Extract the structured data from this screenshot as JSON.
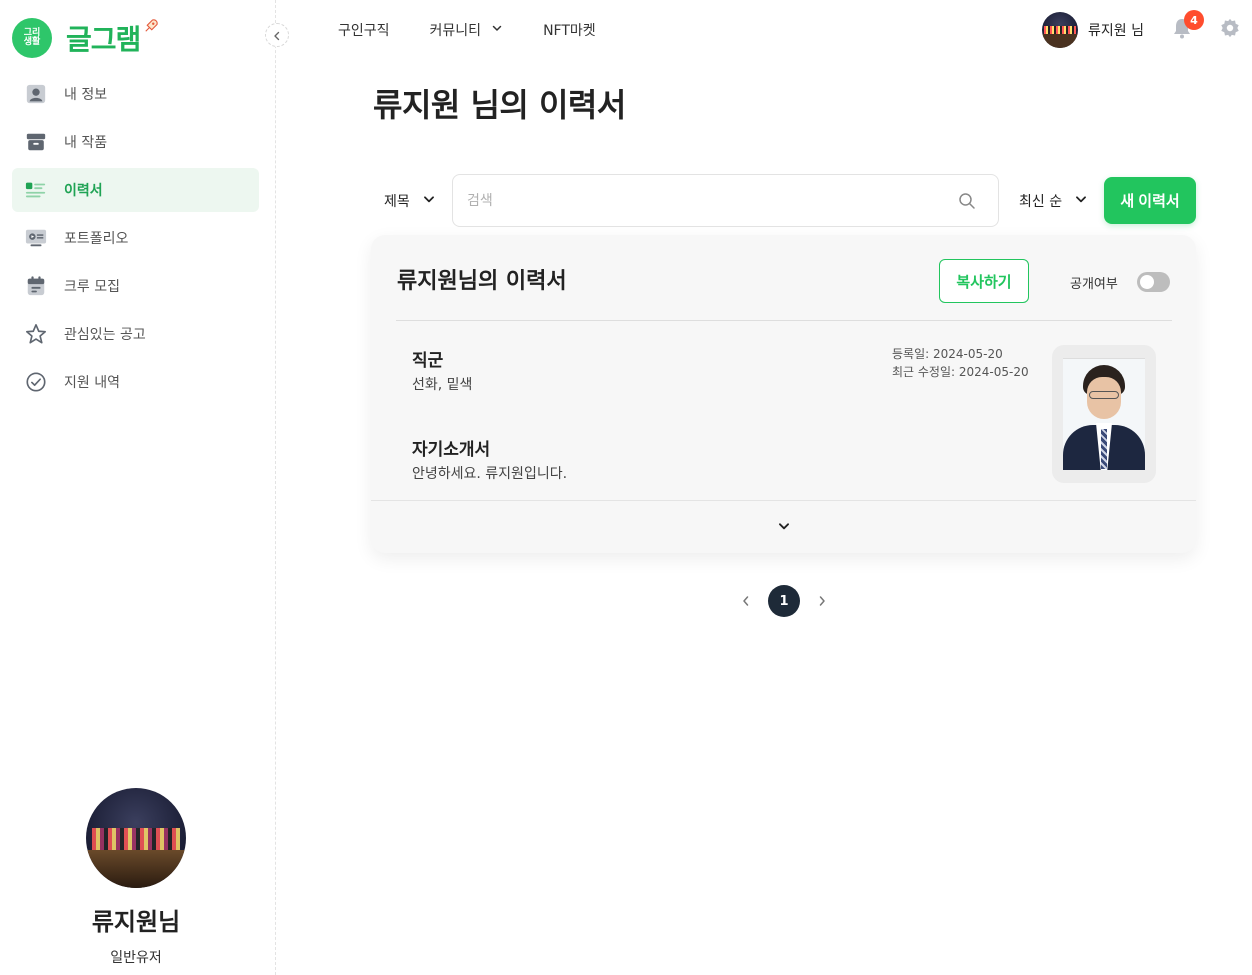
{
  "app": {
    "logo_badge": "그리\n생활",
    "logo_text": "글그램"
  },
  "sidebar": {
    "items": [
      {
        "label": "내 정보",
        "icon": "user-icon",
        "active": false
      },
      {
        "label": "내 작품",
        "icon": "archive-icon",
        "active": false
      },
      {
        "label": "이력서",
        "icon": "resume-icon",
        "active": true
      },
      {
        "label": "포트폴리오",
        "icon": "portfolio-icon",
        "active": false
      },
      {
        "label": "크루 모집",
        "icon": "calendar-icon",
        "active": false
      },
      {
        "label": "관심있는 공고",
        "icon": "star-icon",
        "active": false
      },
      {
        "label": "지원 내역",
        "icon": "check-circle-icon",
        "active": false
      }
    ],
    "profile": {
      "name": "류지원님",
      "role": "일반유저"
    }
  },
  "header": {
    "nav": [
      {
        "label": "구인구직",
        "has_dropdown": false
      },
      {
        "label": "커뮤니티",
        "has_dropdown": true
      },
      {
        "label": "NFT마켓",
        "has_dropdown": false
      }
    ],
    "user_name": "류지원 님",
    "notification_count": "4"
  },
  "main": {
    "title": "류지원 님의 이력서",
    "filter": {
      "field_select": "제목",
      "search_placeholder": "검색",
      "search_value": "",
      "sort_select": "최신 순",
      "new_button": "새 이력서"
    },
    "resume_card": {
      "title": "류지원님의 이력서",
      "copy_button": "복사하기",
      "public_label": "공개여부",
      "public_on": false,
      "job_label": "직군",
      "job_value": "선화, 밑색",
      "intro_label": "자기소개서",
      "intro_value": "안녕하세요. 류지원입니다.",
      "registered": "등록일: 2024-05-20",
      "modified": "최근 수정일: 2024-05-20"
    },
    "pagination": {
      "current": "1"
    }
  },
  "colors": {
    "accent": "#22c55e",
    "active_bg": "#edf7f0",
    "badge": "#ff4d2e",
    "page_active": "#1e2a38"
  }
}
